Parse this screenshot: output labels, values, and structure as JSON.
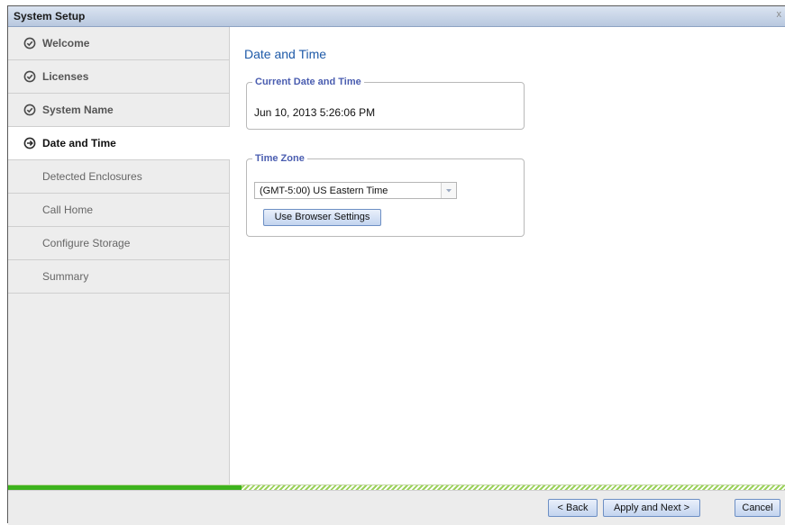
{
  "window": {
    "title": "System Setup",
    "close_glyph": "x"
  },
  "sidebar": {
    "items": [
      {
        "label": "Welcome",
        "state": "done",
        "icon": "check-circle-icon"
      },
      {
        "label": "Licenses",
        "state": "done",
        "icon": "check-circle-icon"
      },
      {
        "label": "System Name",
        "state": "done",
        "icon": "check-circle-icon"
      },
      {
        "label": "Date and Time",
        "state": "active",
        "icon": "arrow-circle-icon"
      },
      {
        "label": "Detected Enclosures",
        "state": "pending"
      },
      {
        "label": "Call Home",
        "state": "pending"
      },
      {
        "label": "Configure Storage",
        "state": "pending"
      },
      {
        "label": "Summary",
        "state": "pending"
      }
    ]
  },
  "main": {
    "title": "Date and Time",
    "current": {
      "legend": "Current Date and Time",
      "value": "Jun 10, 2013 5:26:06 PM"
    },
    "timezone": {
      "legend": "Time Zone",
      "selected": "(GMT-5:00) US Eastern Time",
      "browser_button": "Use Browser Settings"
    }
  },
  "progress": {
    "fraction": 0.3
  },
  "footer": {
    "back": "< Back",
    "apply_next": "Apply and Next >",
    "cancel": "Cancel"
  },
  "colors": {
    "accent": "#1e5aa8",
    "legend": "#4a5db0",
    "progress": "#3db31d"
  }
}
